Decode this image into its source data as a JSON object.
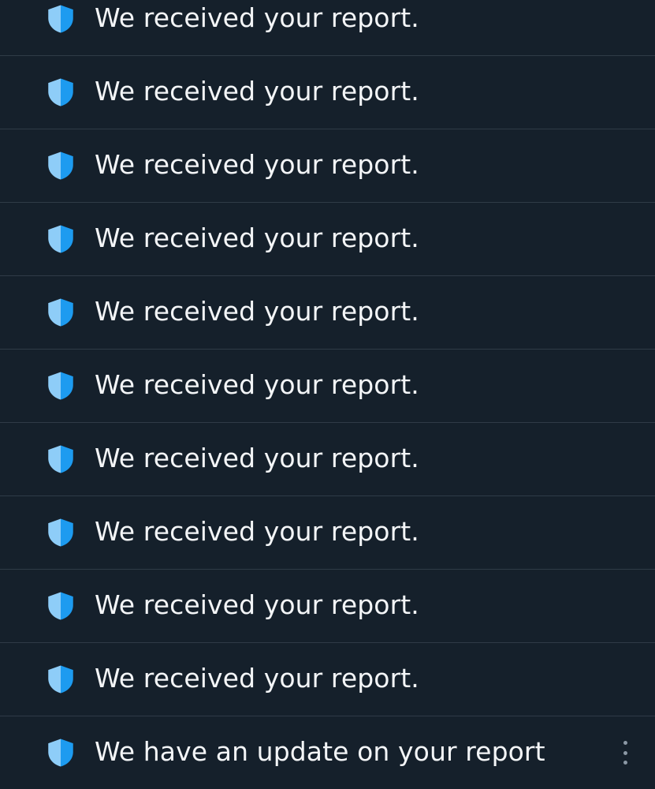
{
  "colors": {
    "background": "#15202b",
    "divider": "#2f3b47",
    "text": "#f3f5f7",
    "shield_light": "#8ecdf8",
    "shield_dark": "#1d9bf0",
    "more_dots": "#8b98a5"
  },
  "notifications": [
    {
      "icon": "shield-icon",
      "text": "We received your report."
    },
    {
      "icon": "shield-icon",
      "text": "We received your report."
    },
    {
      "icon": "shield-icon",
      "text": "We received your report."
    },
    {
      "icon": "shield-icon",
      "text": "We received your report."
    },
    {
      "icon": "shield-icon",
      "text": "We received your report."
    },
    {
      "icon": "shield-icon",
      "text": "We received your report."
    },
    {
      "icon": "shield-icon",
      "text": "We received your report."
    },
    {
      "icon": "shield-icon",
      "text": "We received your report."
    },
    {
      "icon": "shield-icon",
      "text": "We received your report."
    },
    {
      "icon": "shield-icon",
      "text": "We received your report."
    },
    {
      "icon": "shield-icon",
      "text": "We have an update on your report",
      "more_icon": "more-vertical-icon"
    }
  ]
}
